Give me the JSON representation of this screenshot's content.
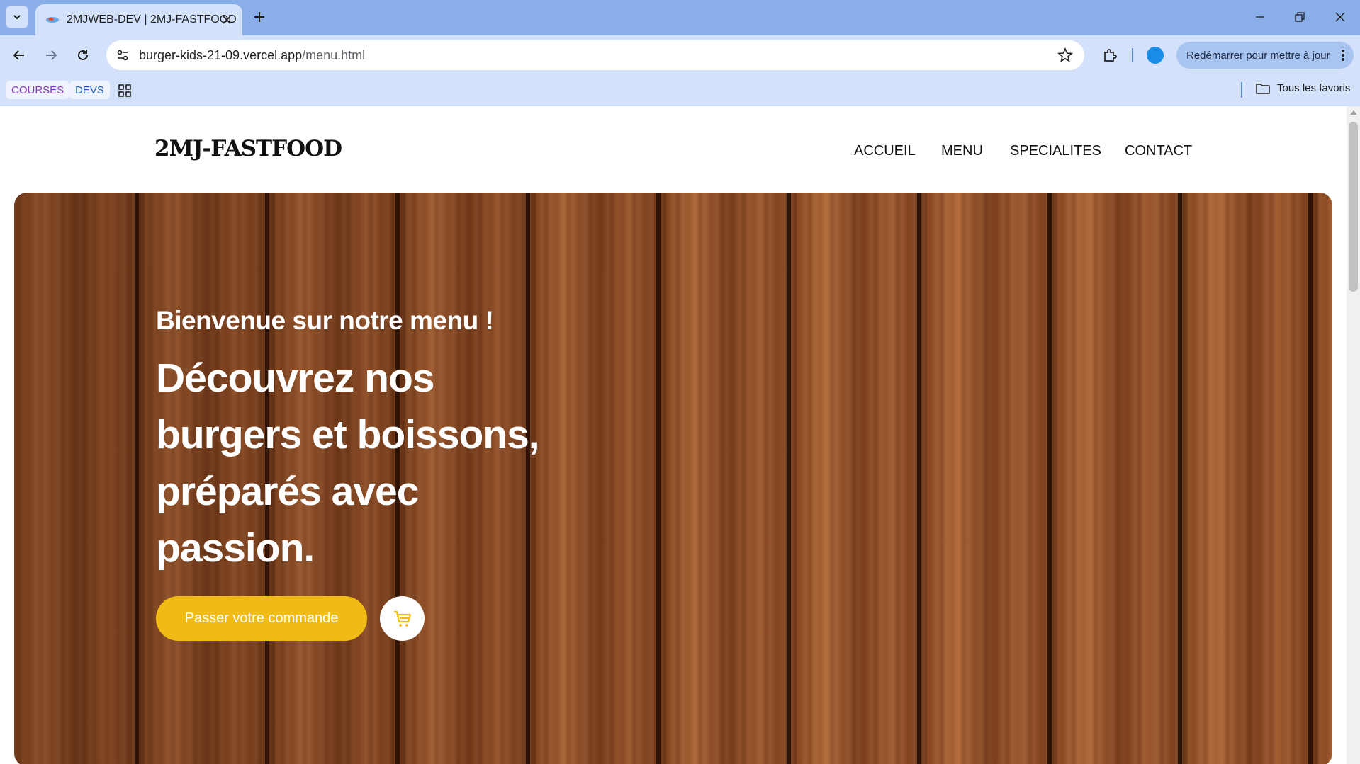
{
  "browser": {
    "tab": {
      "title": "2MJWEB-DEV | 2MJ-FASTFOOD"
    },
    "address_bar": {
      "domain": "burger-kids-21-09.vercel.app",
      "path": "/menu.html"
    },
    "update_button": {
      "label": "Redémarrer pour mettre à jour"
    },
    "bookmarks": {
      "items": [
        {
          "label": "COURSES",
          "color": "#8a3ab9"
        },
        {
          "label": "DEVS",
          "color": "#1a5fb4"
        }
      ],
      "all_bookmarks_label": "Tous les favoris"
    },
    "colors": {
      "tabstrip": "#8aaee8",
      "toolbar": "#d3e2fa"
    }
  },
  "site": {
    "logo": "2MJ-FASTFOOD",
    "nav": [
      "ACCUEIL",
      "MENU",
      "SPECIALITES",
      "CONTACT"
    ],
    "hero": {
      "subtitle": "Bienvenue sur notre menu !",
      "headline": "Découvrez nos burgers et boissons, préparés avec passion.",
      "order_button": "Passer votre commande",
      "cart_icon": "cart-icon"
    },
    "colors": {
      "accent": "#f0bb14",
      "text": "#111111"
    }
  }
}
